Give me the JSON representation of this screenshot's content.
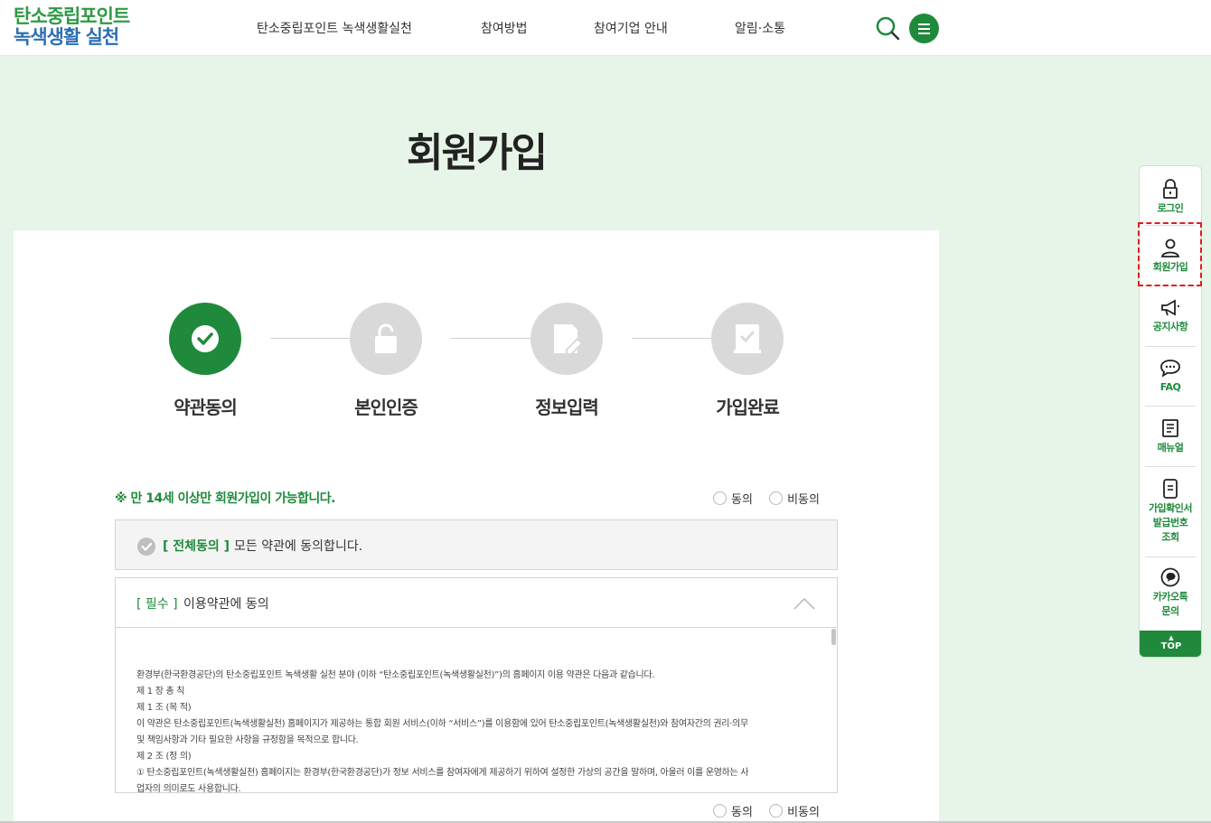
{
  "header": {
    "logo_line1": "탄소중립포인트",
    "logo_line2": "녹색생활 실천",
    "nav": [
      "탄소중립포인트 녹색생활실천",
      "참여방법",
      "참여기업 안내",
      "알림·소통"
    ],
    "search_icon": "search-icon",
    "menu_icon": "hamburger-menu-icon"
  },
  "main": {
    "title": "회원가입",
    "steps": [
      {
        "label": "약관동의",
        "icon": "check-icon",
        "active": true
      },
      {
        "label": "본인인증",
        "icon": "unlock-icon",
        "active": false
      },
      {
        "label": "정보입력",
        "icon": "edit-document-icon",
        "active": false
      },
      {
        "label": "가입완료",
        "icon": "book-check-icon",
        "active": false
      }
    ],
    "age_notice": "※ 만 14세 이상만 회원가입이 가능합니다.",
    "agree_label": "동의",
    "disagree_label": "비동의",
    "all_agree": {
      "tag": "[ 전체동의 ]",
      "text": "모든 약관에 동의합니다."
    },
    "terms": {
      "tag": "[ 필수 ]",
      "title": "이용약관에 동의",
      "body": [
        "환경부(한국환경공단)의 탄소중립포인트 녹색생활 실천 분야 (이하 “탄소중립포인트(녹색생활실천)”)의 홈페이지 이용 약관은 다음과 같습니다.",
        "제 1 장 총 칙",
        "제 1 조 (목 적)",
        "이 약관은 탄소중립포인트(녹색생활실천) 홈페이지가 제공하는 통합 회원 서비스(이하 “서비스”)를 이용함에 있어 탄소중립포인트(녹색생활실천)와 참여자간의 권리·의무",
        "및 책임사항과 기타 필요한 사항을 규정함을 목적으로 합니다.",
        "제 2 조 (정 의)",
        "① 탄소중립포인트(녹색생활실천) 홈페이지는 환경부(한국환경공단)가 정보 서비스를 참여자에게 제공하기 위하여 설정한 가상의 공간을 말하며, 아울러 이를 운영하는 사",
        "업자의 의미로도 사용합니다."
      ]
    }
  },
  "quick_menu": {
    "items": [
      {
        "label": "로그인",
        "icon": "lock-icon"
      },
      {
        "label": "회원가입",
        "icon": "user-icon"
      },
      {
        "label": "공지사항",
        "icon": "megaphone-icon"
      },
      {
        "label": "FAQ",
        "icon": "chat-bubble-icon"
      },
      {
        "label": "매뉴얼",
        "icon": "manual-icon"
      },
      {
        "label": "가입확인서 발급번호 조회",
        "label_lines": [
          "가입확인서",
          "발급번호",
          "조회"
        ],
        "icon": "phone-document-icon"
      },
      {
        "label": "카카오톡 문의",
        "label_lines": [
          "카카오톡",
          "문의"
        ],
        "icon": "kakao-talk-icon"
      }
    ],
    "top_label": "TOP",
    "top_arrow": "▲"
  }
}
